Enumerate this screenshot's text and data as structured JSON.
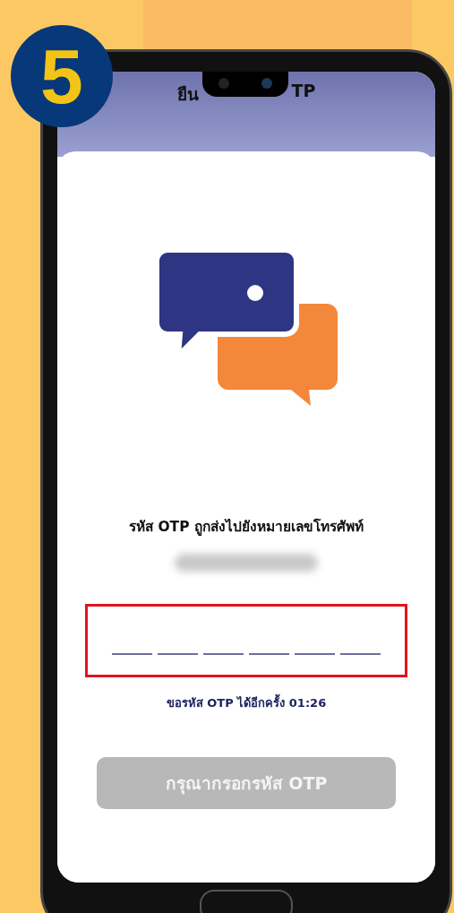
{
  "step_badge": "5",
  "header": {
    "title_visible_parts": [
      "ยืน",
      "TP"
    ]
  },
  "message": "รหัส OTP ถูกส่งไปยังหมายเลขโทรศัพท์",
  "phone_number_blurred": true,
  "otp_slots": [
    {
      "filled": false
    },
    {
      "filled": false
    },
    {
      "filled": false
    },
    {
      "filled": false
    },
    {
      "filled": false
    },
    {
      "filled": false
    }
  ],
  "otp_highlighted": true,
  "resend_text": "ขอรหัส OTP ได้อีกครั้ง 01:26",
  "submit_button": {
    "label": "กรุณากรอกรหัส OTP",
    "disabled": true
  }
}
